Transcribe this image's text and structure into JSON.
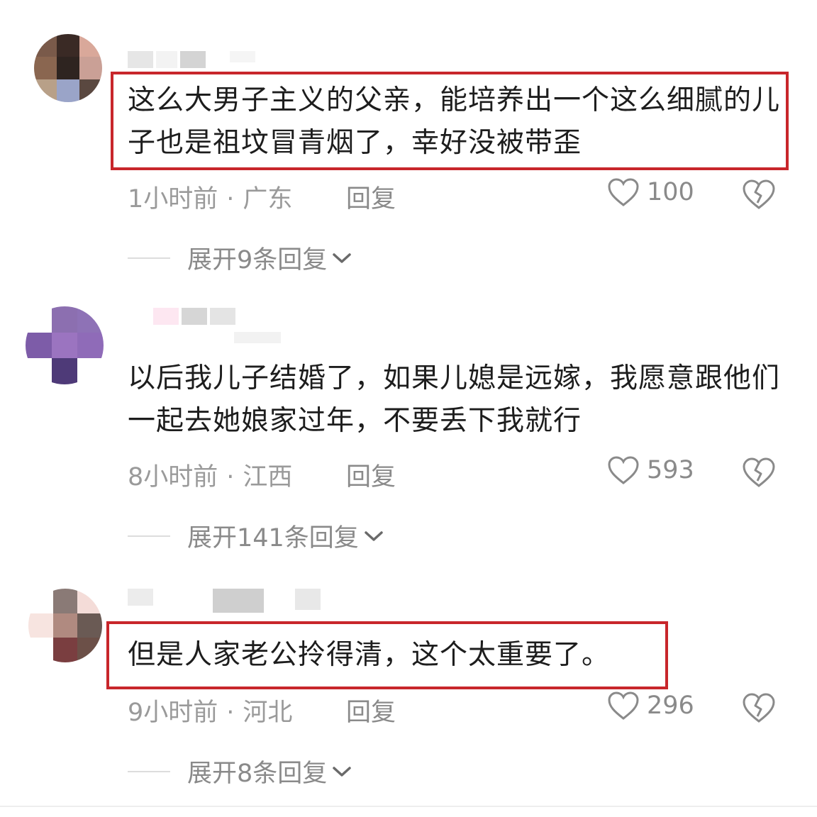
{
  "comments": [
    {
      "text": "这么大男子主义的父亲，能培养出一个这么细腻的儿子也是祖坟冒青烟了，幸好没被带歪",
      "time": "1小时前",
      "location": "广东",
      "reply_label": "回复",
      "likes": "100",
      "expand_label": "展开9条回复",
      "highlighted": true
    },
    {
      "text": "以后我儿子结婚了，如果儿媳是远嫁，我愿意跟他们一起去她娘家过年，不要丢下我就行",
      "time": "8小时前",
      "location": "江西",
      "reply_label": "回复",
      "likes": "593",
      "expand_label": "展开141条回复",
      "highlighted": false
    },
    {
      "text": "但是人家老公拎得清，这个太重要了。",
      "time": "9小时前",
      "location": "河北",
      "reply_label": "回复",
      "likes": "296",
      "expand_label": "展开8条回复",
      "highlighted": true
    }
  ],
  "separator": "·",
  "icons": {
    "like": "heart-outline-icon",
    "dislike": "broken-heart-icon",
    "expand": "chevron-down-icon"
  },
  "colors": {
    "highlight_border": "#c8262b",
    "meta_text": "#9a9a9a",
    "body_text": "#1d1d1d"
  }
}
